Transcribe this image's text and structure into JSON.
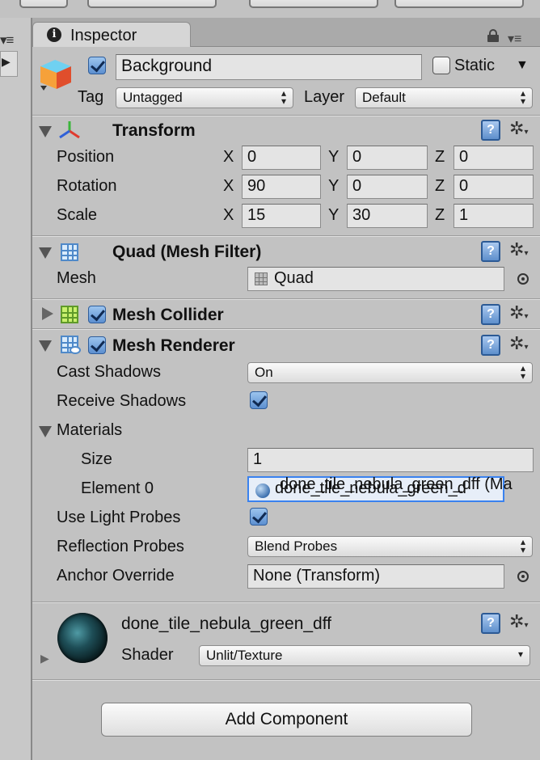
{
  "inspector": {
    "tab_label": "Inspector",
    "menu_glyph": "▾≡"
  },
  "gameobject": {
    "name": "Background",
    "active": true,
    "static_label": "Static",
    "static_checked": false,
    "tag_label": "Tag",
    "tag_value": "Untagged",
    "layer_label": "Layer",
    "layer_value": "Default"
  },
  "transform": {
    "title": "Transform",
    "rows": [
      {
        "label": "Position",
        "x": "0",
        "y": "0",
        "z": "0"
      },
      {
        "label": "Rotation",
        "x": "90",
        "y": "0",
        "z": "0"
      },
      {
        "label": "Scale",
        "x": "15",
        "y": "30",
        "z": "1"
      }
    ],
    "axis_x": "X",
    "axis_y": "Y",
    "axis_z": "Z"
  },
  "mesh_filter": {
    "title": "Quad (Mesh Filter)",
    "mesh_label": "Mesh",
    "mesh_value": "Quad"
  },
  "mesh_collider": {
    "title": "Mesh Collider",
    "enabled": true
  },
  "mesh_renderer": {
    "title": "Mesh Renderer",
    "enabled": true,
    "cast_shadows_label": "Cast Shadows",
    "cast_shadows_value": "On",
    "receive_shadows_label": "Receive Shadows",
    "receive_shadows": true,
    "materials_label": "Materials",
    "size_label": "Size",
    "size_value": "1",
    "element0_label": "Element 0",
    "element0_value": "done_tile_nebula_green_d",
    "drag_ghost_text": "done_tile_nebula_green_dff (Ma",
    "light_probes_label": "Use Light Probes",
    "light_probes": true,
    "reflection_probes_label": "Reflection Probes",
    "reflection_probes_value": "Blend Probes",
    "anchor_override_label": "Anchor Override",
    "anchor_override_value": "None (Transform)"
  },
  "material": {
    "name": "done_tile_nebula_green_dff",
    "shader_label": "Shader",
    "shader_value": "Unlit/Texture"
  },
  "add_component_label": "Add Component",
  "icons": {
    "help": "?",
    "gear": "✲",
    "dropdown_arrows": "⬍"
  },
  "colors": {
    "selection_border": "#3a82ef",
    "checkbox_blue": "#5c8fd0",
    "panel_bg": "#c2c2c2"
  }
}
